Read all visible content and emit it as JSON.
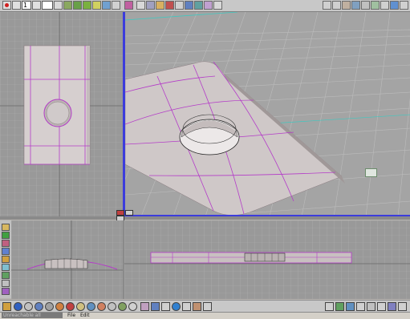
{
  "toolbar": {
    "frame_value": "1",
    "frame_field_empty": ""
  },
  "status": {
    "command_text": "Unreachable all",
    "menus": [
      "File",
      "Edit"
    ]
  },
  "colors": {
    "viewport_bg": "#9a9a9a",
    "grid_line": "#b4b4b4",
    "wire_color": "#b43cc8",
    "active_border": "#3c3cdc",
    "axis_line": "#40c8c0",
    "surface": "#d8d2d2"
  },
  "icons": {
    "toolbar": [
      "red-dot-icon",
      "arrow-icon",
      "key-icon",
      "select-icon",
      "move-icon",
      "rotate-icon",
      "scale-icon",
      "curve-icon",
      "render-icon",
      "snap-icon",
      "lasso-icon",
      "magnet-icon",
      "camera-icon",
      "light-icon",
      "grid-icon",
      "layout-icon"
    ],
    "bottom_shelf": [
      "sphere-icon",
      "cube-icon",
      "cylinder-icon",
      "cone-icon",
      "torus-icon",
      "plane-icon",
      "nurbs-icon",
      "light-icon",
      "camera-icon",
      "material-icon",
      "texture-icon",
      "globe-icon",
      "face-icon",
      "render-icon"
    ],
    "left_shelf": [
      "folder-icon",
      "paint-icon",
      "brush-icon",
      "palette-icon",
      "texture-icon",
      "curve-icon",
      "image-icon",
      "sculpt-icon",
      "layer-icon",
      "settings-icon"
    ]
  }
}
